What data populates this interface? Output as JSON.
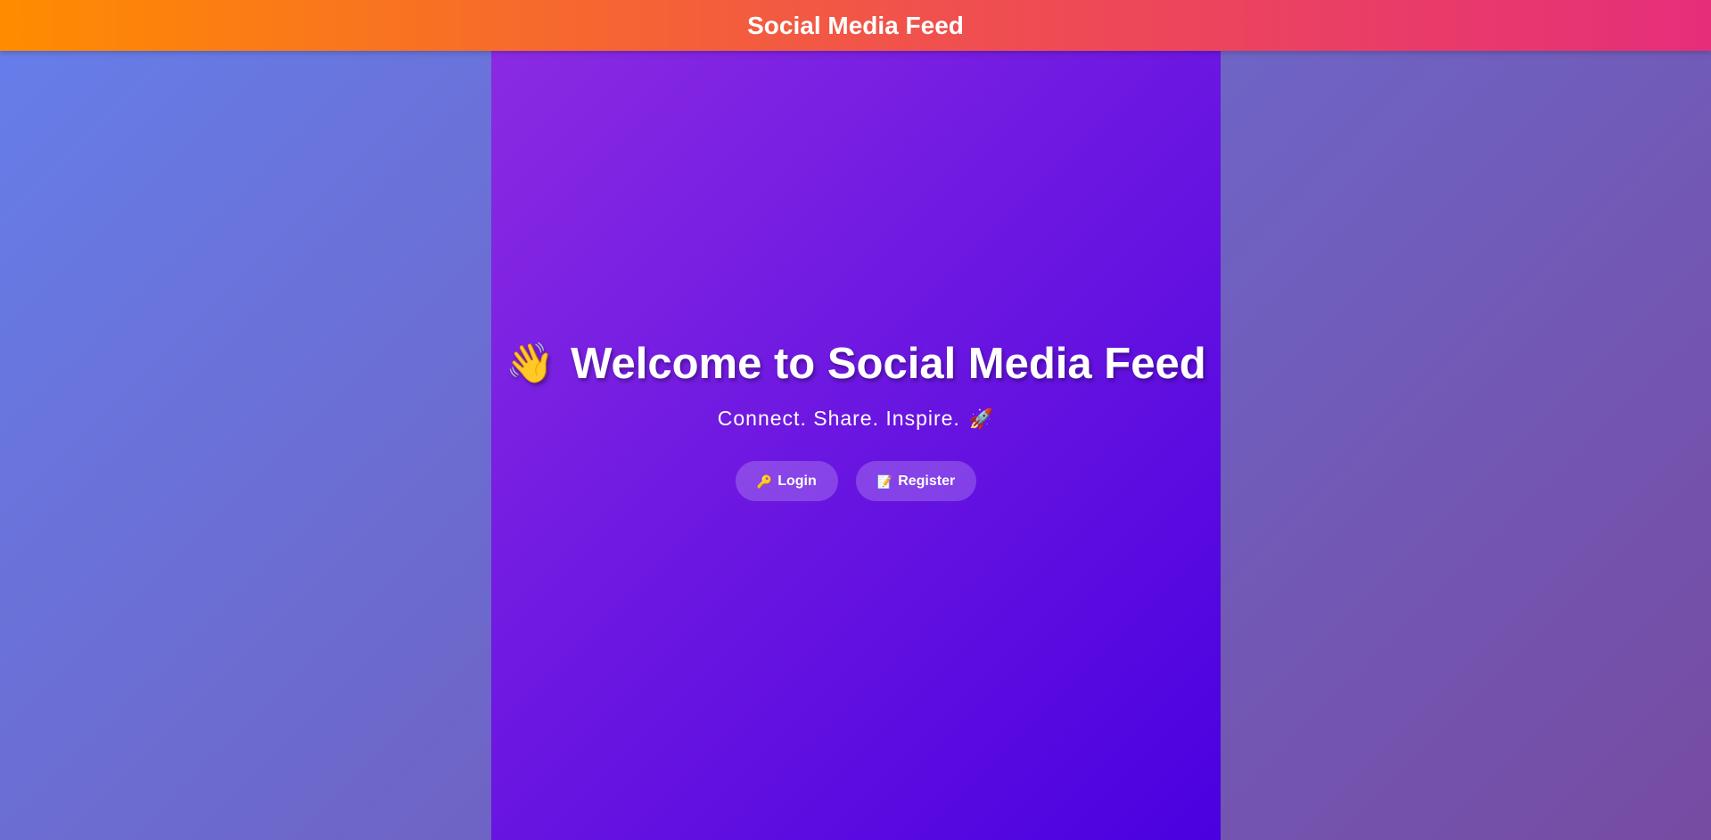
{
  "header": {
    "title": "Social Media Feed"
  },
  "hero": {
    "wave_icon": "👋",
    "title": "Welcome to Social Media Feed",
    "subtitle": "Connect. Share. Inspire.",
    "rocket_icon": "🚀"
  },
  "actions": {
    "login": {
      "icon": "🔑",
      "label": "Login"
    },
    "register": {
      "icon": "📝",
      "label": "Register"
    }
  },
  "colors": {
    "header_gradient_start": "#ff8c00",
    "header_gradient_end": "#e52e7a",
    "page_gradient_start": "#667eea",
    "page_gradient_end": "#764ba2",
    "panel_gradient_start": "#8a2be2",
    "panel_gradient_end": "#4a00e0"
  }
}
